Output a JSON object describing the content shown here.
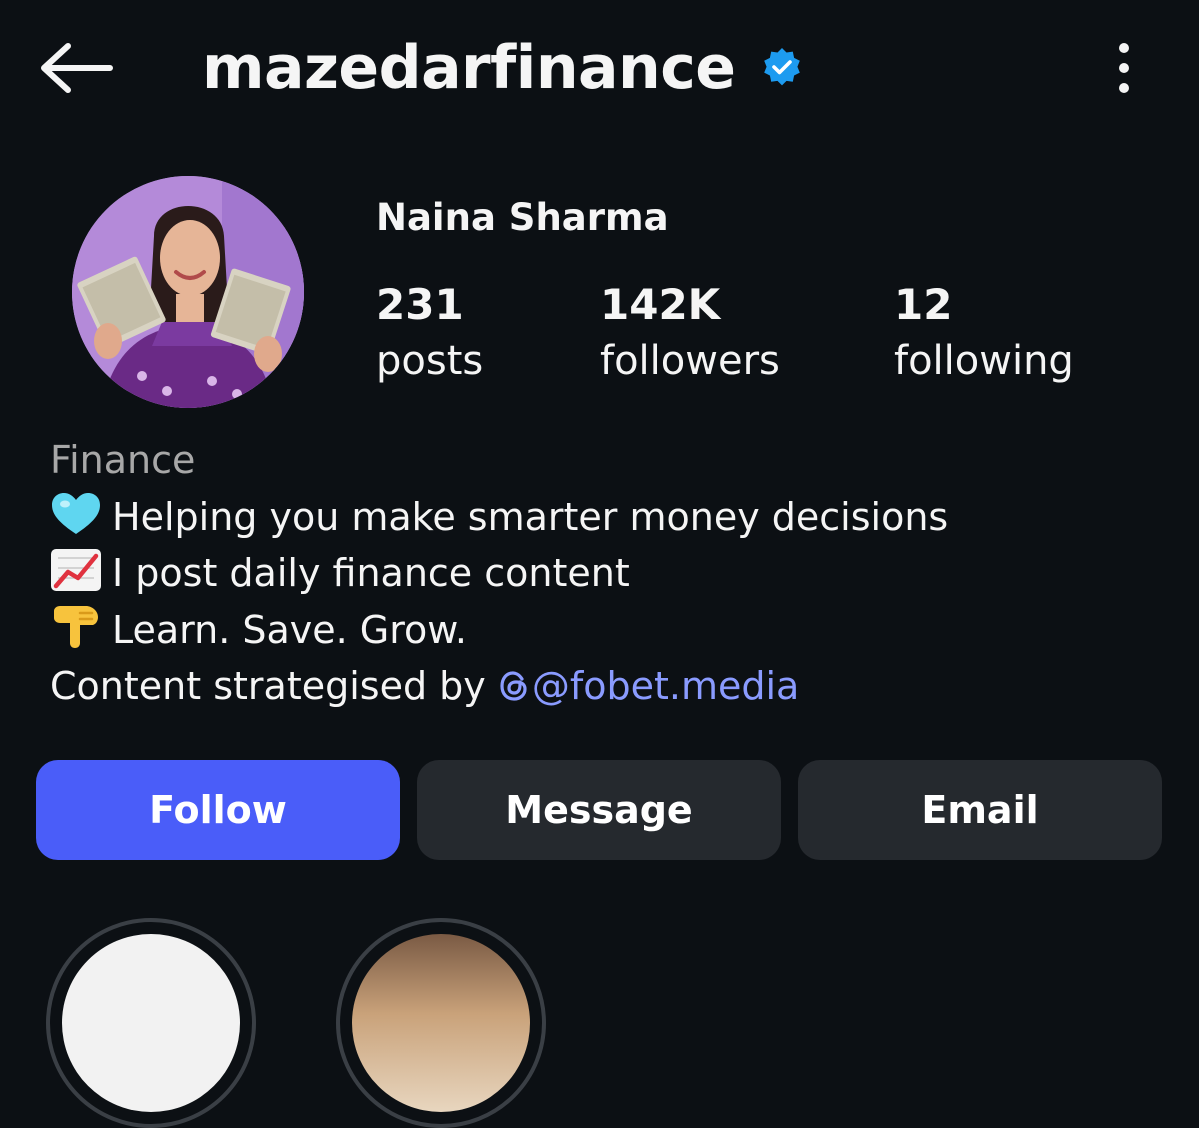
{
  "header": {
    "back_icon": "arrow-left-icon",
    "username": "mazedarfinance",
    "verified_icon": "verified-badge-icon",
    "verified_color": "#1d9bf0",
    "more_icon": "more-vertical-icon"
  },
  "profile": {
    "display_name": "Naina Sharma",
    "avatar": "profile-photo",
    "stats": {
      "posts": {
        "value": "231",
        "label": "posts"
      },
      "followers": {
        "value": "142K",
        "label": "followers"
      },
      "following": {
        "value": "12",
        "label": "following"
      }
    }
  },
  "bio": {
    "category": "Finance",
    "lines": [
      {
        "icon": "blue-heart-icon",
        "text": "Helping you make smarter money decisions"
      },
      {
        "icon": "chart-increasing-icon",
        "text": "I post daily finance content"
      },
      {
        "icon": "pointing-down-icon",
        "text": "Learn. Save. Grow."
      }
    ],
    "credit_prefix": "Content strategised by ",
    "mention": "@fobet.media",
    "mention_color": "#8a9bff"
  },
  "actions": {
    "follow": "Follow",
    "message": "Message",
    "email": "Email",
    "follow_color": "#4a5df9",
    "secondary_color": "#25292e"
  },
  "highlights": [
    {
      "name": "highlight-1"
    },
    {
      "name": "highlight-2"
    }
  ]
}
